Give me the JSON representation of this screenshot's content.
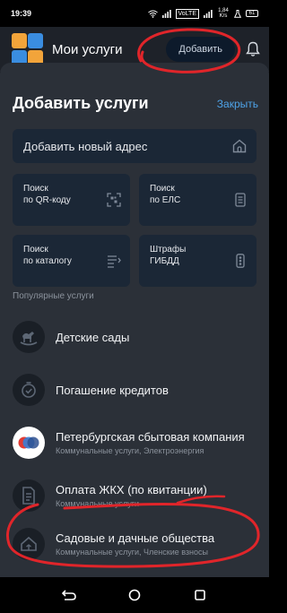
{
  "status_bar": {
    "time": "19:39",
    "volte": "VoLTE",
    "speed": "1,84 K/s",
    "battery": "61"
  },
  "header": {
    "title": "Мои услуги",
    "add_label": "Добавить"
  },
  "sheet": {
    "title": "Добавить услуги",
    "close_label": "Закрыть",
    "add_address": "Добавить новый адрес",
    "tiles": [
      {
        "line1": "Поиск",
        "line2": "по QR-коду"
      },
      {
        "line1": "Поиск",
        "line2": "по ЕЛС"
      },
      {
        "line1": "Поиск",
        "line2": "по каталогу"
      },
      {
        "line1": "Штрафы",
        "line2": "ГИБДД"
      }
    ],
    "popular_label": "Популярные услуги",
    "services": [
      {
        "title": "Детские сады",
        "subtitle": ""
      },
      {
        "title": "Погашение кредитов",
        "subtitle": ""
      },
      {
        "title": "Петербургская сбытовая компания",
        "subtitle": "Коммунальные услуги, Электроэнергия"
      },
      {
        "title": "Оплата ЖКХ (по квитанции)",
        "subtitle": "Коммунальные услуги"
      },
      {
        "title": "Садовые и дачные общества",
        "subtitle": "Коммунальные услуги, Членские взносы"
      }
    ]
  },
  "colors": {
    "sheet": "#2b3038",
    "tile": "#1b2736",
    "accent": "#4ea3e8",
    "annotation": "#e0252a"
  }
}
